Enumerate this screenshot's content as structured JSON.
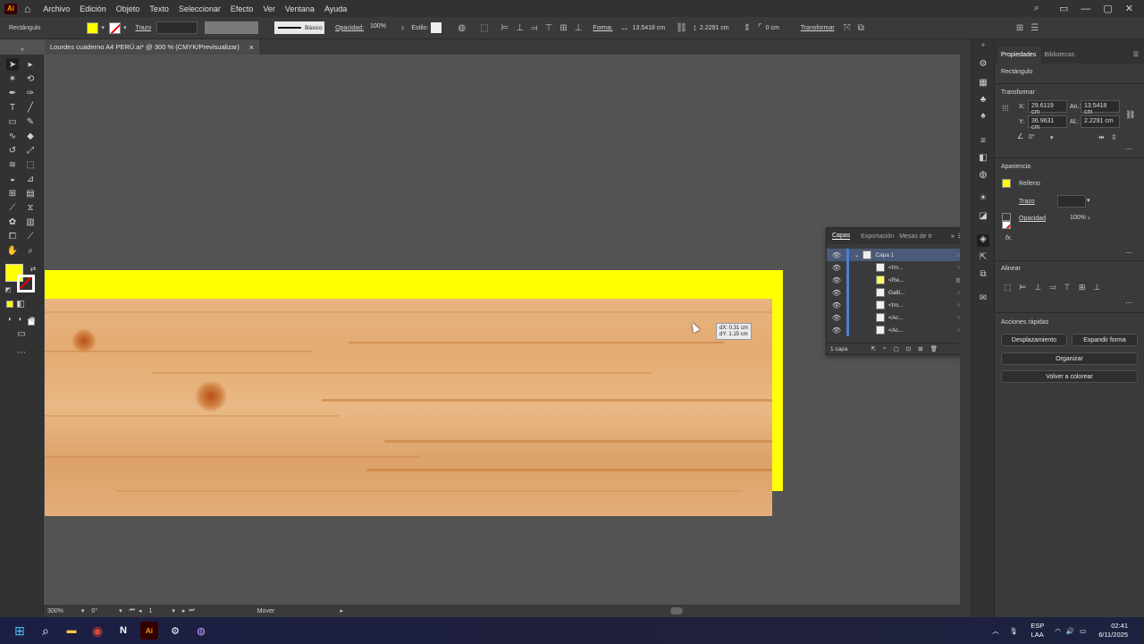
{
  "app": {
    "logo": "Ai",
    "home_icon": "home-icon"
  },
  "menu": [
    "Archivo",
    "Edición",
    "Objeto",
    "Texto",
    "Seleccionar",
    "Efecto",
    "Ver",
    "Ventana",
    "Ayuda"
  ],
  "control": {
    "object_type": "Rectángulo",
    "stroke_label": "Trazo",
    "stroke_style": "Básico",
    "opacity_label": "Opacidad:",
    "opacity_value": "100%",
    "style_label": "Estilo:",
    "shape_label": "Forma:",
    "width_value": "13.5418 cm",
    "height_value": "2.2291 cm",
    "corner_value": "0 cm",
    "transform_label": "Transformar"
  },
  "doc_tab": {
    "title": "Lourdes cuaderno A4 PERÚ.ai* @ 300 % (CMYK/Previsualizar)"
  },
  "status": {
    "zoom": "300%",
    "rotation": "0°",
    "artboard": "1",
    "tool": "Mover"
  },
  "tooltip": {
    "dx": "dX: 0.31 cm",
    "dy": "dY: 1.15 cm"
  },
  "properties": {
    "tabs": [
      "Propiedades",
      "Bibliotecas"
    ],
    "object_type": "Rectángulo",
    "transform": {
      "title": "Transformar",
      "x_label": "X:",
      "x": "29.6119 cm",
      "y_label": "Y:",
      "y": "36.9631 cm",
      "w_label": "An.:",
      "w": "13.5418 cm",
      "h_label": "Al.:",
      "h": "2.2291 cm",
      "angle": "0°"
    },
    "appearance": {
      "title": "Apariencia",
      "fill_label": "Relleno",
      "stroke_label": "Trazo",
      "opacity_label": "Opacidad",
      "opacity": "100%",
      "fx": "fx."
    },
    "align": {
      "title": "Alinear"
    },
    "quick_actions": {
      "title": "Acciones rápidas",
      "offset": "Desplazamiento",
      "expand": "Expandir forma",
      "arrange": "Organizar",
      "recolor": "Volver a colorear"
    }
  },
  "layers": {
    "tabs": [
      "Capas",
      "Exportación",
      "Mesas de tr"
    ],
    "rows": [
      {
        "name": "Capa 1"
      },
      {
        "name": "<Im..."
      },
      {
        "name": "<Re..."
      },
      {
        "name": "Galli..."
      },
      {
        "name": "<Im..."
      },
      {
        "name": "<Ac..."
      },
      {
        "name": "<Ac..."
      }
    ],
    "count": "1 capa"
  },
  "taskbar": {
    "lang1": "ESP",
    "lang2": "LAA",
    "time": "02:41",
    "date": "6/11/2025"
  },
  "colors": {
    "fill": "#ffff00",
    "accent": "#4b7fd1"
  }
}
